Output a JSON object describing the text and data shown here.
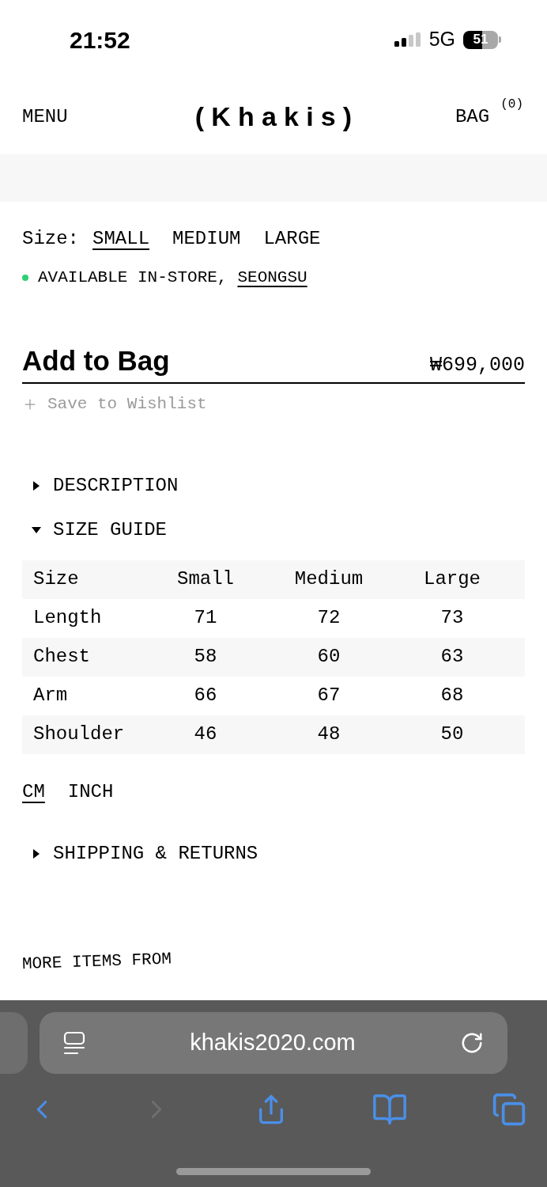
{
  "status_bar": {
    "time": "21:52",
    "network": "5G",
    "battery": "51"
  },
  "header": {
    "menu": "MENU",
    "logo": "(Khakis)",
    "bag": "BAG",
    "bag_count": "(0)"
  },
  "size_selector": {
    "label": "Size:",
    "options": [
      {
        "label": "SMALL",
        "selected": true
      },
      {
        "label": "MEDIUM",
        "selected": false
      },
      {
        "label": "LARGE",
        "selected": false
      }
    ]
  },
  "availability": {
    "text": "AVAILABLE IN-STORE,",
    "store": "SEONGSU"
  },
  "add_to_bag": {
    "label": "Add to Bag",
    "price": "₩699,000"
  },
  "wishlist": {
    "label": "Save to Wishlist"
  },
  "accordion": [
    {
      "title": "DESCRIPTION",
      "expanded": false
    },
    {
      "title": "SIZE GUIDE",
      "expanded": true,
      "table": {
        "columns": [
          "Size",
          "Small",
          "Medium",
          "Large"
        ],
        "rows": [
          [
            "Length",
            "71",
            "72",
            "73"
          ],
          [
            "Chest",
            "58",
            "60",
            "63"
          ],
          [
            "Arm",
            "66",
            "67",
            "68"
          ],
          [
            "Shoulder",
            "46",
            "48",
            "50"
          ]
        ]
      },
      "units": [
        {
          "label": "CM",
          "selected": true
        },
        {
          "label": "INCH",
          "selected": false
        }
      ]
    },
    {
      "title": "SHIPPING & RETURNS",
      "expanded": false
    }
  ],
  "more_items": {
    "heading": "MORE ITEMS FROM"
  },
  "browser": {
    "url": "khakis2020.com"
  }
}
